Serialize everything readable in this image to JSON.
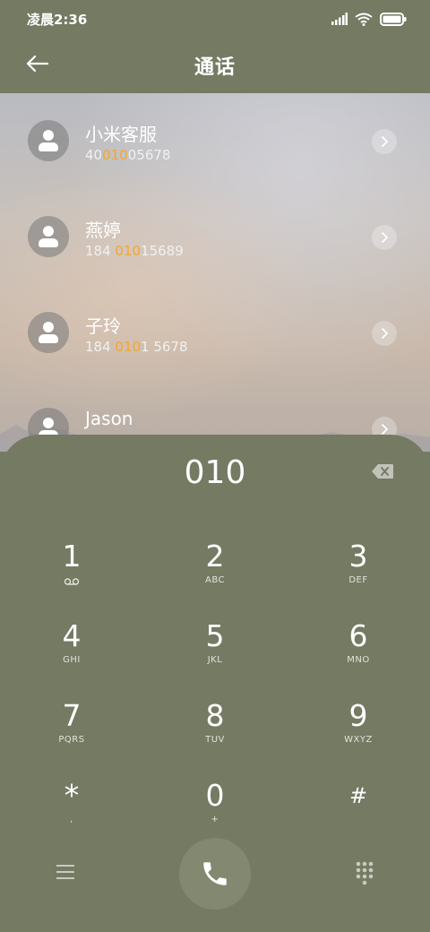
{
  "status_bar": {
    "time": "凌晨2:36",
    "icons": [
      "signal-icon",
      "wifi-icon",
      "battery-icon"
    ]
  },
  "header": {
    "title": "通话",
    "back_icon": "back-arrow-icon"
  },
  "contacts": [
    {
      "name": "小米客服",
      "number_pre": "40",
      "number_match": "010",
      "number_post": "05678"
    },
    {
      "name": "燕婷",
      "number_pre": "184 ",
      "number_match": "010",
      "number_post": "15689"
    },
    {
      "name": "子玲",
      "number_pre": "184 ",
      "number_match": "010",
      "number_post": "1 5678"
    },
    {
      "name": "Jason",
      "number_pre": "",
      "number_match": "",
      "number_post": ""
    }
  ],
  "dialer": {
    "input": "010",
    "keys": [
      {
        "digit": "1",
        "letters": ""
      },
      {
        "digit": "2",
        "letters": "ABC"
      },
      {
        "digit": "3",
        "letters": "DEF"
      },
      {
        "digit": "4",
        "letters": "GHI"
      },
      {
        "digit": "5",
        "letters": "JKL"
      },
      {
        "digit": "6",
        "letters": "MNO"
      },
      {
        "digit": "7",
        "letters": "PQRS"
      },
      {
        "digit": "8",
        "letters": "TUV"
      },
      {
        "digit": "9",
        "letters": "WXYZ"
      },
      {
        "digit": "*",
        "letters": ","
      },
      {
        "digit": "0",
        "letters": "+"
      },
      {
        "digit": "#",
        "letters": ""
      }
    ]
  },
  "colors": {
    "background": "#757a63",
    "highlight": "#f2a82c",
    "call_button": "#838970"
  }
}
